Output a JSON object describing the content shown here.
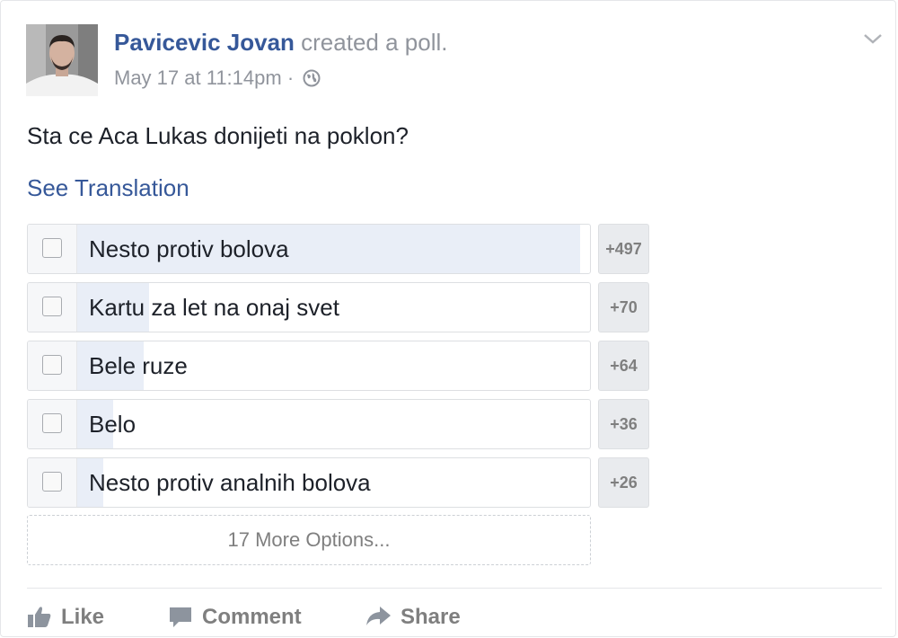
{
  "post": {
    "author": "Pavicevic Jovan",
    "action": " created a poll.",
    "timestamp": "May 17 at 11:14pm",
    "separator": " · ",
    "privacy_icon": "globe-icon",
    "question": "Sta ce Aca Lukas donijeti na poklon?",
    "see_translation": "See Translation"
  },
  "poll": {
    "options": [
      {
        "label": "Nesto protiv bolova",
        "votes": "+497",
        "fill_fraction": 0.98
      },
      {
        "label": "Kartu za let na onaj svet",
        "votes": "+70",
        "fill_fraction": 0.14
      },
      {
        "label": "Bele ruze",
        "votes": "+64",
        "fill_fraction": 0.13
      },
      {
        "label": "Belo",
        "votes": "+36",
        "fill_fraction": 0.07
      },
      {
        "label": "Nesto protiv analnih bolova",
        "votes": "+26",
        "fill_fraction": 0.05
      }
    ],
    "more_options": "17 More Options..."
  },
  "actions": {
    "like": "Like",
    "comment": "Comment",
    "share": "Share"
  },
  "colors": {
    "link": "#365899",
    "muted": "#90949c",
    "fill": "#e9eef7"
  }
}
